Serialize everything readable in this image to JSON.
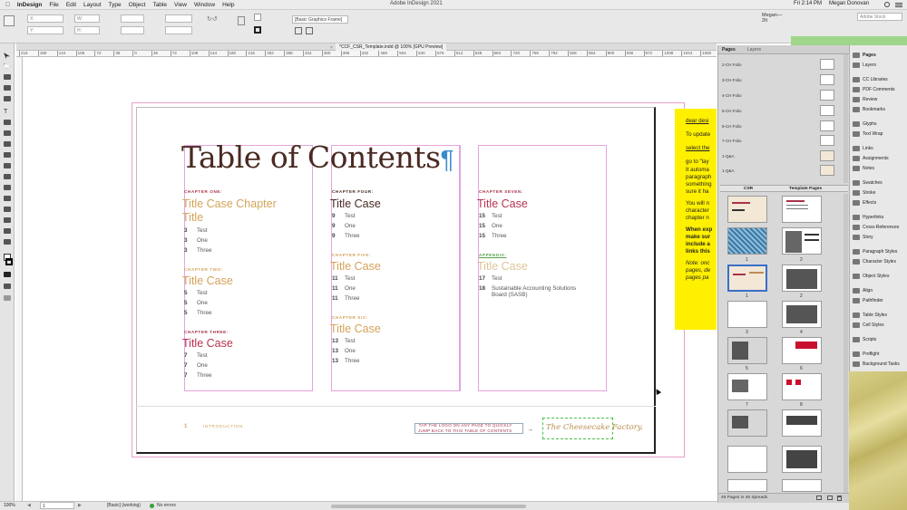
{
  "menubar": {
    "apple": "",
    "app": "InDesign",
    "items": [
      "File",
      "Edit",
      "Layout",
      "Type",
      "Object",
      "Table",
      "View",
      "Window",
      "Help"
    ],
    "title": "Adobe InDesign 2021",
    "time": "Fri 2:14 PM",
    "user": "Megan Donovan",
    "battery": "%"
  },
  "controlbar": {
    "frame_style": "[Basic Graphics Frame]",
    "workspace": "Megan—2It",
    "search_placeholder": "Adobe Stock"
  },
  "document": {
    "tab": "*CCF_CSR_Template.indd @ 100% [GPU Preview]",
    "ruler_ticks": [
      "216",
      "180",
      "144",
      "108",
      "72",
      "36",
      "0",
      "36",
      "72",
      "108",
      "144",
      "180",
      "216",
      "252",
      "288",
      "324",
      "360",
      "396",
      "432",
      "468",
      "504",
      "540",
      "576",
      "612",
      "648",
      "684",
      "720",
      "756",
      "792",
      "828",
      "864",
      "900",
      "936",
      "972",
      "1008",
      "1044",
      "1080"
    ]
  },
  "toc": {
    "title": "Table of Contents",
    "pilcrow": "¶",
    "col1": [
      {
        "label": "CHAPTER ONE:",
        "title_line1": "Title Case Chapter",
        "title_line2": "Title",
        "entries": [
          {
            "num": "3",
            "text": "Test"
          },
          {
            "num": "3",
            "text": "One"
          },
          {
            "num": "3",
            "text": "Three"
          }
        ]
      },
      {
        "label": "CHAPTER TWO:",
        "title": "Title Case",
        "entries": [
          {
            "num": "5",
            "text": "Test"
          },
          {
            "num": "5",
            "text": "One"
          },
          {
            "num": "5",
            "text": "Three"
          }
        ]
      },
      {
        "label": "CHAPTER THREE:",
        "title": "Title Case",
        "entries": [
          {
            "num": "7",
            "text": "Test"
          },
          {
            "num": "7",
            "text": "One"
          },
          {
            "num": "7",
            "text": "Three"
          }
        ]
      }
    ],
    "col2": [
      {
        "label": "CHAPTER FOUR:",
        "title": "Title Case",
        "entries": [
          {
            "num": "9",
            "text": "Test"
          },
          {
            "num": "9",
            "text": "One"
          },
          {
            "num": "9",
            "text": "Three"
          }
        ]
      },
      {
        "label": "CHAPTER FIVE:",
        "title": "Title Case",
        "entries": [
          {
            "num": "11",
            "text": "Test"
          },
          {
            "num": "11",
            "text": "One"
          },
          {
            "num": "11",
            "text": "Three"
          }
        ]
      },
      {
        "label": "CHAPTER SIX:",
        "title": "Title Case",
        "entries": [
          {
            "num": "13",
            "text": "Test"
          },
          {
            "num": "13",
            "text": "One"
          },
          {
            "num": "13",
            "text": "Three"
          }
        ]
      }
    ],
    "col3": [
      {
        "label": "CHAPTER SEVEN:",
        "title": "Title Case",
        "entries": [
          {
            "num": "15",
            "text": "Test"
          },
          {
            "num": "15",
            "text": "One"
          },
          {
            "num": "15",
            "text": "Three"
          }
        ]
      },
      {
        "label": "APPENDIX:",
        "title": "Title Case",
        "entries": [
          {
            "num": "17",
            "text": "Test"
          },
          {
            "num": "18",
            "text": "Sustainable Accounting Solutions"
          },
          {
            "num": "",
            "text": "Board (SASB)"
          }
        ]
      }
    ],
    "footer": {
      "page": "1",
      "section": "INTRODUCTION",
      "tap_line1": "TAP THE LOGO ON ANY PAGE TO QUICKLY",
      "tap_line2": "JUMP BACK TO THIS TABLE OF CONTENTS",
      "logo": "The Cheesecake Factory."
    }
  },
  "sticky": {
    "lines": [
      "dear desi",
      "To update",
      "select the",
      "go to \"lay",
      "It automa",
      "paragraph",
      "something",
      "sure it ha",
      "You will n",
      "character",
      "chapter n",
      "When exp",
      "make sur",
      "include a",
      "links this",
      "Note: onc",
      "pages, de",
      "pages pa"
    ]
  },
  "pages_panel": {
    "tabs": [
      "Pages",
      "Layers"
    ],
    "folios": [
      "2-CH Folio",
      "3-CH Folio",
      "4-CH Folio",
      "5-CH Folio",
      "6-CH Folio",
      "7-CH Folio",
      "1-Q&A",
      "1-Q&A"
    ],
    "csr_label": "CSR",
    "template_label": "Template Pages",
    "page_numbers": [
      "1",
      "2",
      "1",
      "2",
      "3",
      "4",
      "5",
      "6",
      "7",
      "8"
    ],
    "status": "46 Pages in 46 Spreads"
  },
  "right_panel": {
    "items": [
      "Pages",
      "Layers",
      "CC Libraries",
      "PDF Comments",
      "Review",
      "Bookmarks",
      "Glyphs",
      "Text Wrap",
      "Links",
      "Assignments",
      "Notes",
      "Swatches",
      "Stroke",
      "Effects",
      "Hyperlinks",
      "Cross-References",
      "Story",
      "Paragraph Styles",
      "Character Styles",
      "Object Styles",
      "Align",
      "Pathfinder",
      "Table Styles",
      "Cell Styles",
      "Scripts",
      "Preflight",
      "Background Tasks"
    ]
  },
  "statusbar": {
    "zoom": "100%",
    "page": "1",
    "style": "[Basic] (working)",
    "errors": "No errors"
  },
  "colors": {
    "brown": "#4a2a22",
    "chapter_label": "#a8324a",
    "title_pink": "#b8334f",
    "gold": "#d4a35a",
    "appendix_green": "#5aa04a",
    "sticky": "#fff000"
  }
}
